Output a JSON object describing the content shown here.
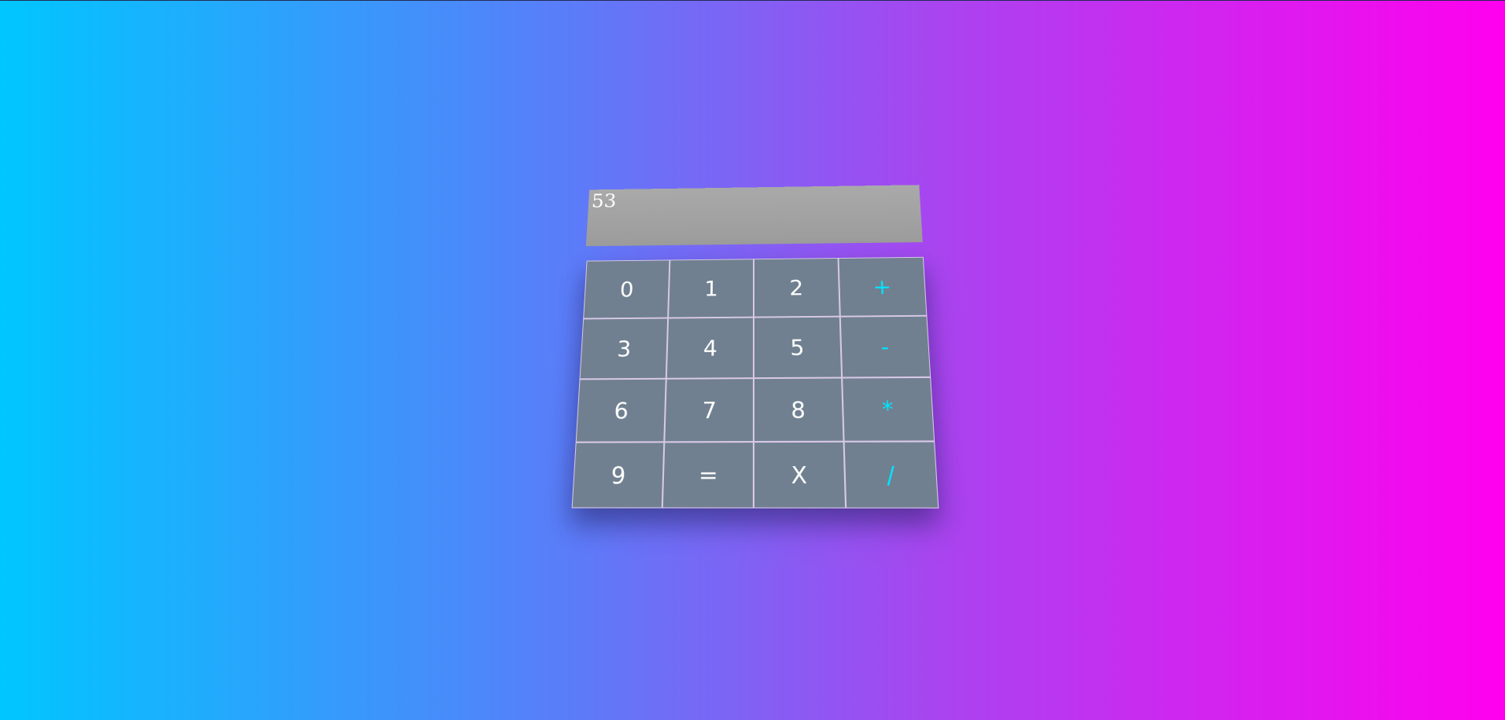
{
  "display": {
    "value": "53"
  },
  "keys": [
    {
      "label": "0",
      "type": "digit"
    },
    {
      "label": "1",
      "type": "digit"
    },
    {
      "label": "2",
      "type": "digit"
    },
    {
      "label": "+",
      "type": "operator"
    },
    {
      "label": "3",
      "type": "digit"
    },
    {
      "label": "4",
      "type": "digit"
    },
    {
      "label": "5",
      "type": "digit"
    },
    {
      "label": "-",
      "type": "operator"
    },
    {
      "label": "6",
      "type": "digit"
    },
    {
      "label": "7",
      "type": "digit"
    },
    {
      "label": "8",
      "type": "digit"
    },
    {
      "label": "*",
      "type": "operator"
    },
    {
      "label": "9",
      "type": "digit"
    },
    {
      "label": "=",
      "type": "equals"
    },
    {
      "label": "X",
      "type": "clear"
    },
    {
      "label": "/",
      "type": "operator"
    }
  ],
  "colors": {
    "key_background": "#708090",
    "digit_text": "#ffffff",
    "operator_text": "#00e5ff",
    "display_background": "#a9a9a9",
    "gradient_start": "#00c6ff",
    "gradient_end": "#ff00ee"
  }
}
